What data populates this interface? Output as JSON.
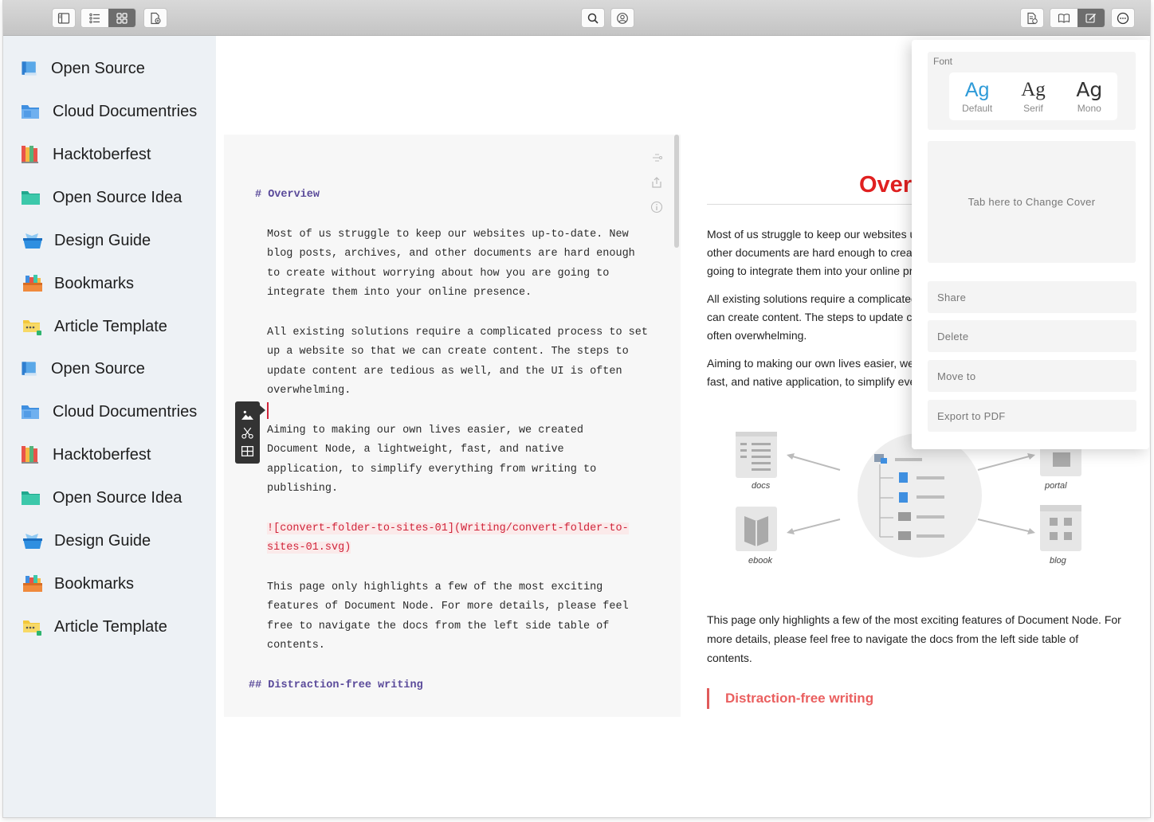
{
  "toolbar": {
    "left_icons": [
      "sidebar-toggle-icon",
      "list-view-icon",
      "grid-view-icon",
      "new-document-icon"
    ],
    "center_icons": [
      "search-icon",
      "account-icon"
    ],
    "right_icons": [
      "document-info-icon",
      "reading-mode-icon",
      "edit-mode-icon",
      "more-options-icon"
    ]
  },
  "sidebar": {
    "items": [
      {
        "label": "Open Source",
        "icon": "blue-book-icon"
      },
      {
        "label": "Cloud Documentries",
        "icon": "blue-folder-icon"
      },
      {
        "label": "Hacktoberfest",
        "icon": "colorful-books-icon"
      },
      {
        "label": "Open Source Idea",
        "icon": "teal-folder-icon"
      },
      {
        "label": "Design Guide",
        "icon": "open-box-icon"
      },
      {
        "label": "Bookmarks",
        "icon": "bookmark-books-icon"
      },
      {
        "label": "Article Template",
        "icon": "yellow-folder-icon"
      },
      {
        "label": "Open Source",
        "icon": "blue-book-icon"
      },
      {
        "label": "Cloud Documentries",
        "icon": "blue-folder-icon"
      },
      {
        "label": "Hacktoberfest",
        "icon": "colorful-books-icon"
      },
      {
        "label": "Open Source Idea",
        "icon": "teal-folder-icon"
      },
      {
        "label": "Design Guide",
        "icon": "open-box-icon"
      },
      {
        "label": "Bookmarks",
        "icon": "bookmark-books-icon"
      },
      {
        "label": "Article Template",
        "icon": "yellow-folder-icon"
      }
    ]
  },
  "editor": {
    "heading1": "# Overview",
    "para1": [
      "Most of us struggle to keep our websites up-to-date. New",
      "blog posts, archives, and other documents are hard enough",
      "to create without worrying about how you are going to",
      "integrate them into your online presence."
    ],
    "para2": [
      "All existing solutions require a complicated process to set",
      "up a website so that we can create content. The steps to",
      "update content are tedious as well, and the UI is often",
      "overwhelming."
    ],
    "para3": [
      "Aiming to making our own lives easier, we created",
      "Document Node, a lightweight, fast, and native",
      "application, to simplify everything from writing to",
      "publishing."
    ],
    "image_md": [
      "![convert-folder-to-sites-01](Writing/convert-folder-to-",
      "sites-01.svg)"
    ],
    "para4": [
      "This page only highlights a few of the most exciting",
      "features of Document Node. For more details, please feel",
      "free to navigate the docs from the left side table of",
      "contents."
    ],
    "heading2": "## Distraction-free writing",
    "side_icons": [
      "outline-icon",
      "share-icon",
      "info-icon"
    ],
    "float_tools": [
      "insert-image-icon",
      "cut-icon",
      "insert-table-icon"
    ]
  },
  "preview": {
    "title": "Overv",
    "para1": [
      "Most of us struggle to keep our websites up",
      "other documents are hard enough to create",
      "going to integrate them into your online pres"
    ],
    "para2": [
      "All existing solutions require a complicated",
      "can create content. The steps to update co",
      "often overwhelming."
    ],
    "para3": [
      "Aiming to making our own lives easier, we c",
      "fast, and native application, to simplify ever"
    ],
    "diagram_labels": {
      "docs": "docs",
      "ebook": "ebook",
      "portal": "portal",
      "blog": "blog"
    },
    "para4": [
      "This page only highlights a few of the most exciting features of Document Node. For",
      "more details, please feel free to navigate the docs from the left side table of",
      "contents."
    ],
    "subheading": "Distraction-free writing",
    "colors": {
      "title": "#e02020",
      "subheading": "#ea5f5f"
    }
  },
  "popover": {
    "font_caption": "Font",
    "fonts": [
      {
        "sample": "Ag",
        "name": "Default",
        "selected": true
      },
      {
        "sample": "Ag",
        "name": "Serif",
        "selected": false
      },
      {
        "sample": "Ag",
        "name": "Mono",
        "selected": false
      }
    ],
    "cover_text": "Tab here to Change Cover",
    "actions": [
      "Share",
      "Delete",
      "Move to",
      "Export to PDF"
    ],
    "accent": "#2f9bd8"
  }
}
